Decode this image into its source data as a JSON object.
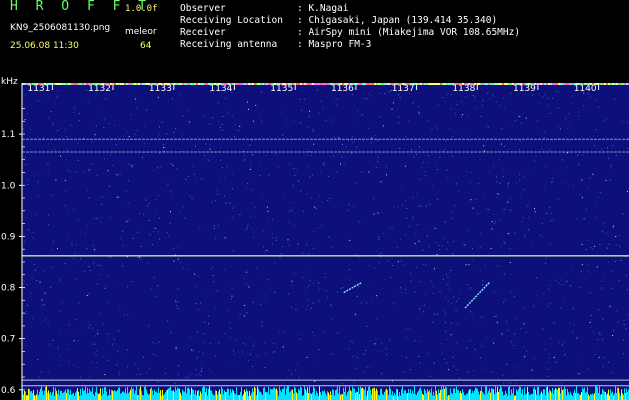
{
  "header": {
    "brand": "H R O F F T",
    "version": "1.0.0f",
    "file_name": "KN9_2506081130.png",
    "file_unit": "meleor",
    "timestamp": "25.06.08 11:30",
    "file_count": "64",
    "info": [
      {
        "label": "Observer",
        "value": ": K.Nagai"
      },
      {
        "label": "Receiving Location",
        "value": ": Chigasaki, Japan (139.414 35.340)"
      },
      {
        "label": "Receiver",
        "value": ": AirSpy mini (Miakejima VOR 108.65MHz)"
      },
      {
        "label": "Receiving antenna",
        "value": ": Maspro FM-3"
      }
    ]
  },
  "colors": {
    "background": "#000000",
    "header_brand": "#66ff66",
    "header_time": "#ffff66",
    "header_text": "#ffffff",
    "plot_background": "#0d0f7a",
    "noise_speck": "#5a8cff",
    "horizontal_line": "#9fd4ff",
    "strong_line": "#c8ff9f",
    "bottom_bar_cyan": "#00e5ff",
    "bottom_bar_yellow": "#ffff00"
  },
  "chart_data": {
    "type": "heatmap",
    "y_axis_unit": "kHz",
    "y_ticks": [
      "1.1",
      "1.0",
      "0.9",
      "0.8",
      "0.7",
      "0.6"
    ],
    "y_tick_values": [
      1.1,
      1.0,
      0.9,
      0.8,
      0.7,
      0.6
    ],
    "ylim": [
      0.58,
      1.2
    ],
    "x_ticks": [
      "1131",
      "1132",
      "1133",
      "1134",
      "1135",
      "1136",
      "1137",
      "1138",
      "1139",
      "1140"
    ],
    "xlim": [
      1130.5,
      1140.5
    ],
    "horizontal_lines_khz": [
      1.09,
      1.065,
      0.862,
      0.619,
      0.608
    ],
    "meteor_echoes": [
      {
        "x1": 1135.8,
        "y1": 0.79,
        "x2": 1136.1,
        "y2": 0.81
      },
      {
        "x1": 1137.8,
        "y1": 0.76,
        "x2": 1138.2,
        "y2": 0.81
      }
    ]
  }
}
